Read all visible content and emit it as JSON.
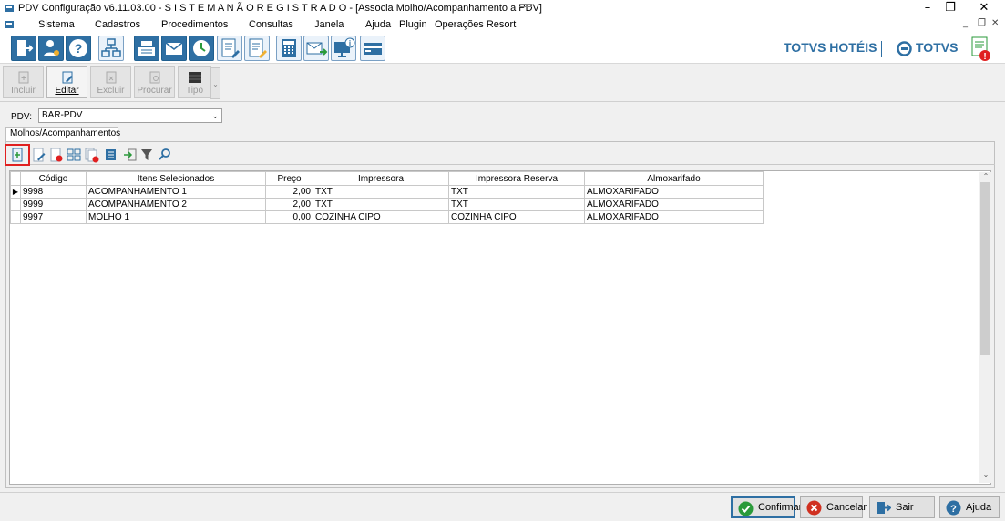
{
  "window": {
    "title": "PDV Configuração v6.11.03.00 - S I S T E M A  N Ã O  R E G I S T R A D O  - [Associa Molho/Acompanhamento a PDV]",
    "minimize": "–",
    "maximize": "❐",
    "close": "✕"
  },
  "menu": {
    "items": [
      "Sistema",
      "Cadastros",
      "Procedimentos",
      "Consultas",
      "Janela",
      "Ajuda",
      "Plugin",
      "Operações Resort"
    ],
    "mdi_minimize": "_",
    "mdi_restore": "❐",
    "mdi_close": "✕"
  },
  "brand": {
    "hotels": "TOTVS HOTÉIS",
    "totvs": "TOTVS"
  },
  "toolbar2": {
    "incluir": "Incluir",
    "editar": "Editar",
    "excluir": "Excluir",
    "procurar": "Procurar",
    "tipo": "Tipo",
    "dropdown": "⌄"
  },
  "form": {
    "pdv_label": "PDV:",
    "pdv_value": "BAR-PDV",
    "tab": "Molhos/Acompanhamentos"
  },
  "grid": {
    "columns": [
      "Código",
      "Itens Selecionados",
      "Preço",
      "Impressora",
      "Impressora Reserva",
      "Almoxarifado"
    ],
    "rows": [
      {
        "codigo": "9998",
        "item": "ACOMPANHAMENTO 1",
        "preco": "2,00",
        "impressora": "TXT",
        "reserva": "TXT",
        "almox": "ALMOXARIFADO"
      },
      {
        "codigo": "9999",
        "item": "ACOMPANHAMENTO 2",
        "preco": "2,00",
        "impressora": "TXT",
        "reserva": "TXT",
        "almox": "ALMOXARIFADO"
      },
      {
        "codigo": "9997",
        "item": "MOLHO 1",
        "preco": "0,00",
        "impressora": "COZINHA CIPO",
        "reserva": "COZINHA CIPO",
        "almox": "ALMOXARIFADO"
      }
    ],
    "current_row_marker": "▶"
  },
  "buttons": {
    "confirmar": "Confirmar",
    "cancelar": "Cancelar",
    "sair": "Sair",
    "ajuda": "Ajuda"
  },
  "colors": {
    "accent": "#2e6fa3",
    "highlight": "#e02020",
    "confirm": "#2a9a3a",
    "cancel": "#d03020"
  }
}
